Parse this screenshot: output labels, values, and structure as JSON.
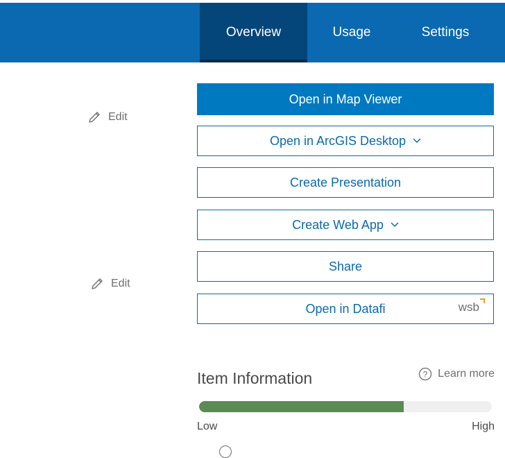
{
  "nav": {
    "tabs": [
      {
        "label": "Overview",
        "active": true
      },
      {
        "label": "Usage",
        "active": false
      },
      {
        "label": "Settings",
        "active": false
      }
    ]
  },
  "edit_links": [
    {
      "label": "Edit"
    },
    {
      "label": "Edit"
    }
  ],
  "actions": {
    "open_map_viewer": "Open in Map Viewer",
    "open_arcgis_desktop": "Open in ArcGIS Desktop",
    "create_presentation": "Create Presentation",
    "create_web_app": "Create Web App",
    "share": "Share",
    "open_datafi": "Open in Datafi",
    "datafi_logo": "wsb"
  },
  "item_information": {
    "title": "Item Information",
    "learn_more": "Learn more",
    "progress_fraction": 0.7,
    "low_label": "Low",
    "high_label": "High"
  },
  "colors": {
    "header_bg": "#0a69b0",
    "active_tab_bg": "#05467a",
    "primary_button": "#0079c1",
    "progress_fill": "#5b8a54"
  }
}
